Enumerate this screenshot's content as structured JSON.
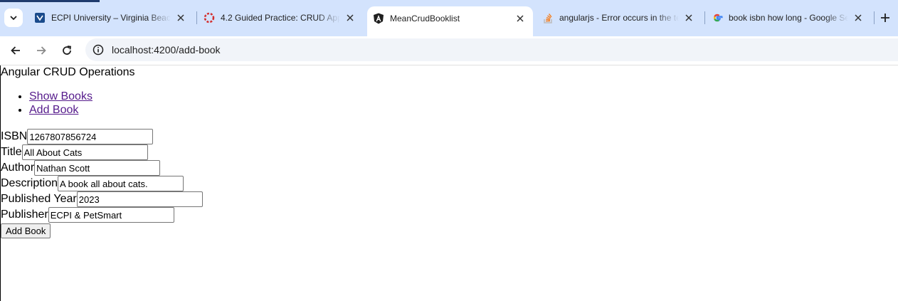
{
  "browser": {
    "tabs": [
      {
        "title": "ECPI University – Virginia Beach",
        "icon": "shield-icon",
        "active": false
      },
      {
        "title": "4.2 Guided Practice: CRUD Appl",
        "icon": "lifebuoy-icon",
        "active": false
      },
      {
        "title": "MeanCrudBooklist",
        "icon": "angular-icon",
        "active": true
      },
      {
        "title": "angularjs - Error occurs in the te",
        "icon": "stackoverflow-icon",
        "active": false
      },
      {
        "title": "book isbn how long - Google Se",
        "icon": "google-icon",
        "active": false
      }
    ],
    "url": "localhost:4200/add-book"
  },
  "app": {
    "title": "Angular CRUD Operations",
    "nav": [
      "Show Books",
      "Add Book"
    ]
  },
  "form": {
    "fields": [
      {
        "label": "ISBN",
        "value": "1267807856724"
      },
      {
        "label": "Title",
        "value": "All About Cats"
      },
      {
        "label": "Author",
        "value": "Nathan Scott"
      },
      {
        "label": "Description",
        "value": "A book all about cats."
      },
      {
        "label": "Published Year",
        "value": "2023"
      },
      {
        "label": "Publisher",
        "value": "ECPI & PetSmart"
      }
    ],
    "submit_label": "Add Book"
  }
}
